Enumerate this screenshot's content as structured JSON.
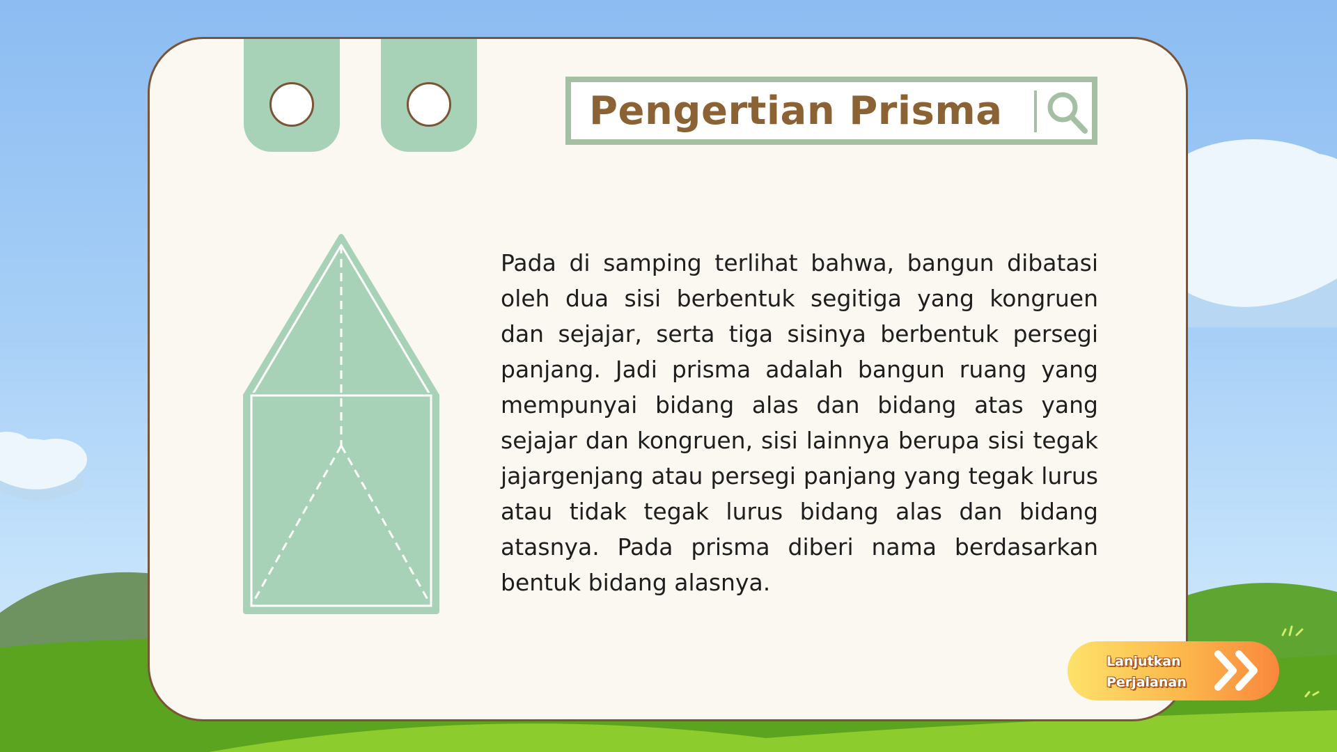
{
  "slide": {
    "title": "Pengertian Prisma",
    "paragraph": "Pada di samping terlihat bahwa, bangun dibatasi oleh dua sisi berbentuk segitiga yang kongruen dan sejajar, serta tiga sisinya berbentuk persegi panjang. Jadi prisma adalah bangun ruang yang mempunyai bidang alas dan bidang atas yang sejajar dan kongruen, sisi lainnya berupa sisi tegak jajargenjang atau persegi panjang yang tegak lurus atau tidak tegak lurus bidang alas dan bidang atasnya. Pada prisma diberi nama berdasarkan bentuk bidang alasnya."
  },
  "continue_button": {
    "line1": "Lanjutkan",
    "line2": "Perjalanan",
    "icon": "double-chevron-right-icon"
  },
  "colors": {
    "card_background": "#fbf7f1",
    "card_border": "#7a5436",
    "accent_green": "#a8d2b8",
    "title_text": "#8a6234",
    "title_border": "#a5bfa4",
    "button_gradient_start": "#fde26a",
    "button_gradient_end": "#f9873d"
  },
  "icons": {
    "title_icon": "search-icon",
    "illustration": "triangular-prism-illustration"
  }
}
